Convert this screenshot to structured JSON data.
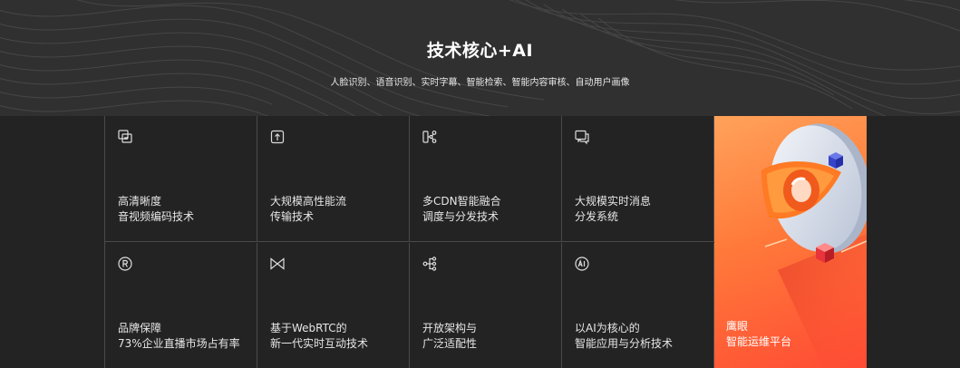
{
  "header": {
    "title": "技术核心+AI",
    "subtitle": "人脸识别、语音识别、实时字幕、智能检索、智能内容审核、自动用户画像"
  },
  "tiles": [
    {
      "icon": "hd-video-icon",
      "line1": "高清晰度",
      "line2": "音视频编码技术"
    },
    {
      "icon": "upload-stream-icon",
      "line1": "大规模高性能流",
      "line2": "传输技术"
    },
    {
      "icon": "cdn-share-icon",
      "line1": "多CDN智能融合",
      "line2": "调度与分发技术"
    },
    {
      "icon": "message-icon",
      "line1": "大规模实时消息",
      "line2": "分发系统"
    },
    {
      "icon": "registered-trademark-icon",
      "line1": "品牌保障",
      "line2": "73%企业直播市场占有率"
    },
    {
      "icon": "bowtie-connect-icon",
      "line1": "基于WebRTC的",
      "line2": "新一代实时互动技术"
    },
    {
      "icon": "architecture-flow-icon",
      "line1": "开放架构与",
      "line2": "广泛适配性"
    },
    {
      "icon": "ai-circle-icon",
      "line1": "以AI为核心的",
      "line2": "智能应用与分析技术"
    }
  ],
  "feature": {
    "line1": "鹰眼",
    "line2": "智能运维平台"
  },
  "colors": {
    "background": "#232323",
    "hero_background": "#303030",
    "grid_line": "#4a4a4a",
    "feature_gradient_start": "#ffa25a",
    "feature_gradient_end": "#ff4b34"
  }
}
